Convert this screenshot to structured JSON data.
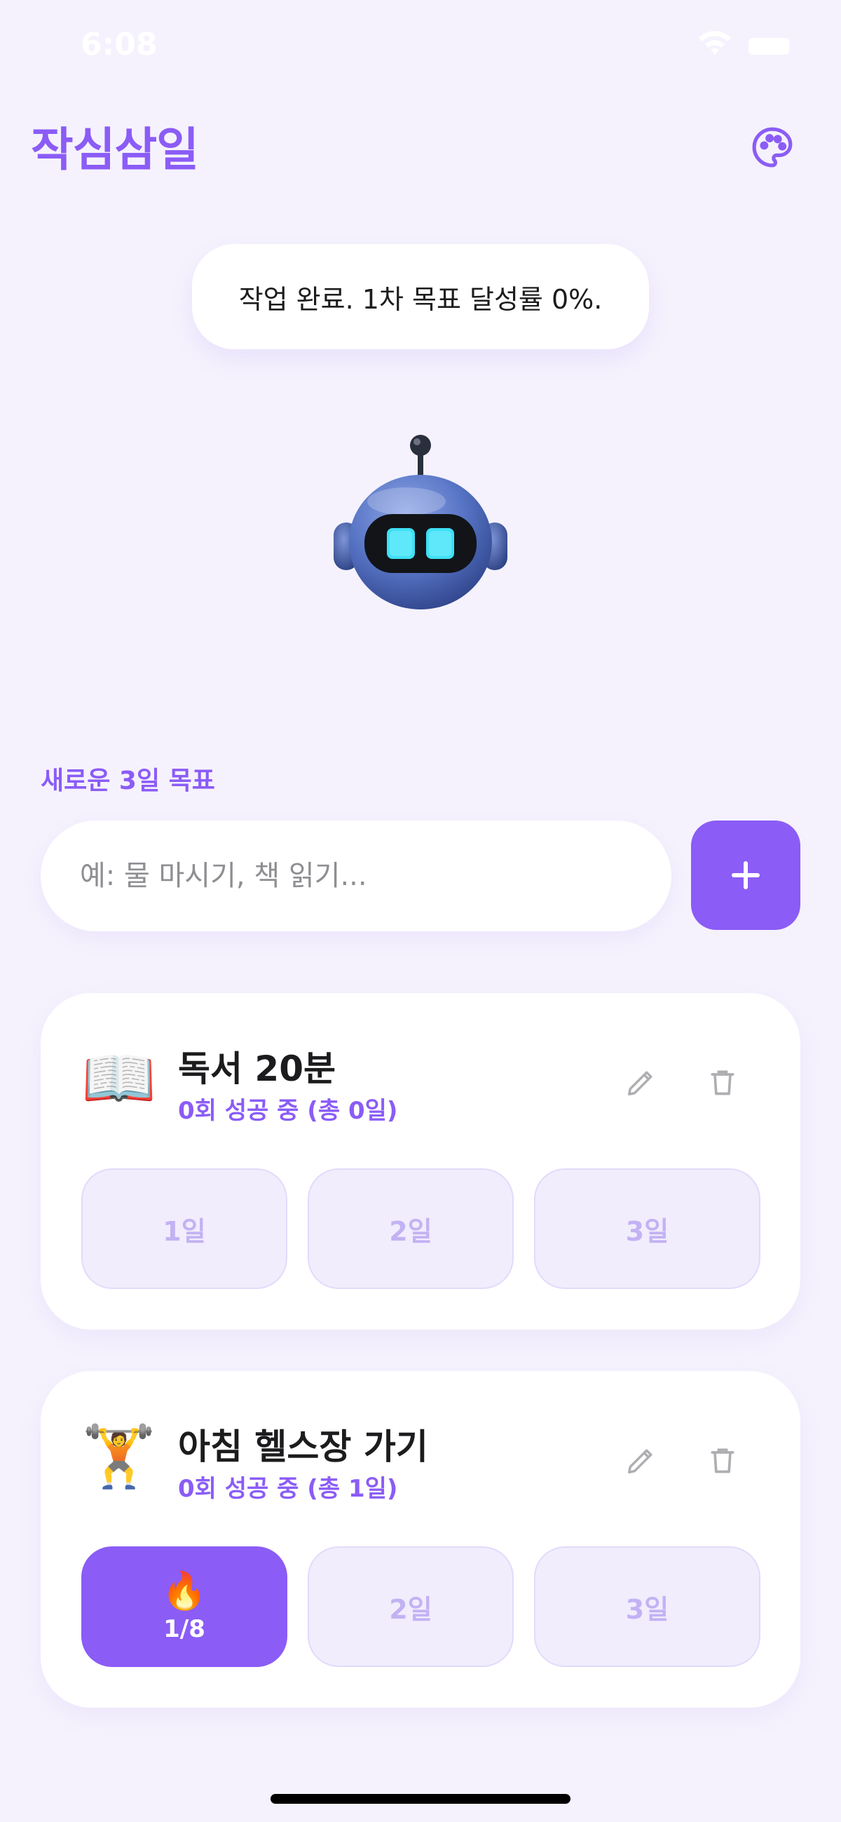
{
  "status_bar": {
    "time": "6:08"
  },
  "header": {
    "title": "작심삼일",
    "palette_icon": "palette-icon"
  },
  "bubble": {
    "message": "작업 완료. 1차 목표 달성률 0%."
  },
  "new_goal": {
    "label": "새로운 3일 목표",
    "placeholder": "예: 물 마시기, 책 읽기...",
    "value": ""
  },
  "goals": [
    {
      "emoji": "📖",
      "title": "독서 20분",
      "streak": "0회 성공 중 (총 0일)",
      "days": [
        {
          "label": "1일",
          "done": false
        },
        {
          "label": "2일",
          "done": false
        },
        {
          "label": "3일",
          "done": false
        }
      ]
    },
    {
      "emoji": "🏋️",
      "title": "아침 헬스장 가기",
      "streak": "0회 성공 중 (총 1일)",
      "days": [
        {
          "label": "1/8",
          "done": true,
          "icon": "🔥"
        },
        {
          "label": "2일",
          "done": false
        },
        {
          "label": "3일",
          "done": false
        }
      ]
    }
  ],
  "colors": {
    "accent": "#8b5cf6",
    "background": "#f5f2fd",
    "day_inactive": "#f1edfd",
    "day_inactive_text": "#c3b2f3"
  }
}
